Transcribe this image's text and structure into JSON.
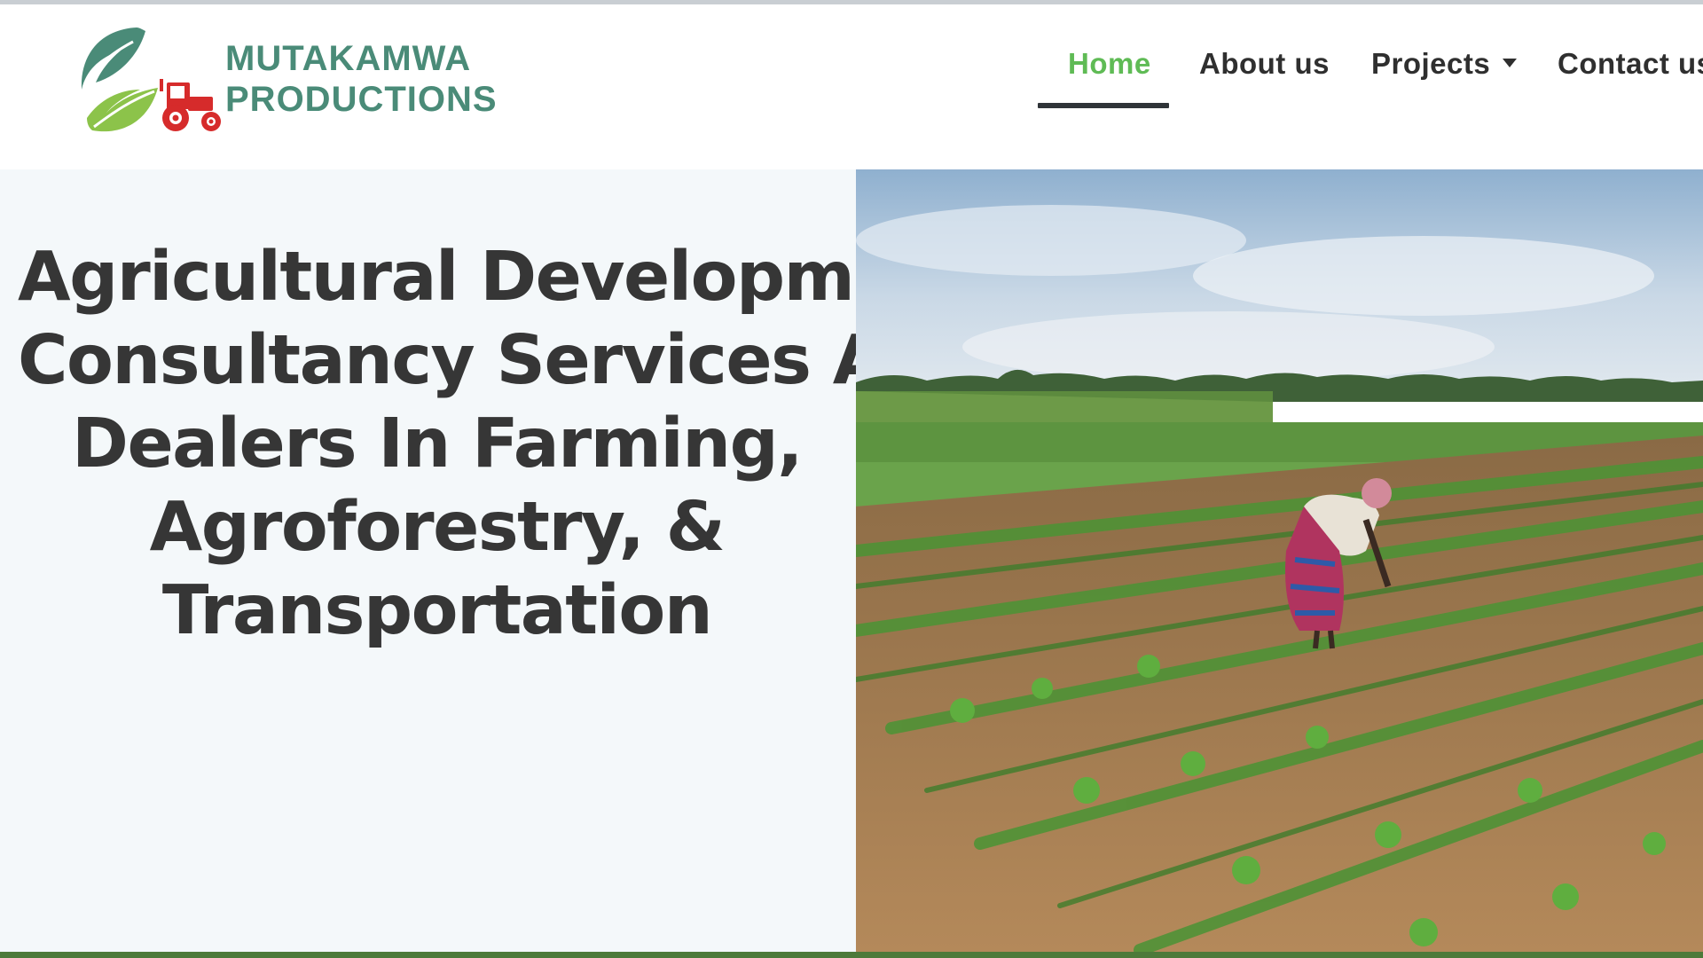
{
  "brand": {
    "name_line1": "MUTAKAMWA",
    "name_line2": "PRODUCTIONS",
    "text_color": "#4a8b78",
    "leaf_colors": [
      "#4a8b78",
      "#8cc34a"
    ],
    "tractor_color": "#d62b2b"
  },
  "nav": {
    "items": [
      {
        "label": "Home",
        "active": true
      },
      {
        "label": "About us",
        "active": false
      },
      {
        "label": "Projects",
        "active": false,
        "has_dropdown": true,
        "dropdown_icon": "caret-down-icon"
      },
      {
        "label": "Contact us",
        "active": false
      }
    ],
    "active_color": "#5fbb55",
    "text_color": "#2f2f2f"
  },
  "hero": {
    "title_lines": [
      "Agricultural Development",
      "Consultancy Services And",
      "Dealers In Farming,",
      "Agroforestry, &",
      "Transportation"
    ],
    "background_color": "#f4f8fa",
    "title_color": "#363636"
  },
  "colors": {
    "footer_bar": "#4d7a3a"
  }
}
